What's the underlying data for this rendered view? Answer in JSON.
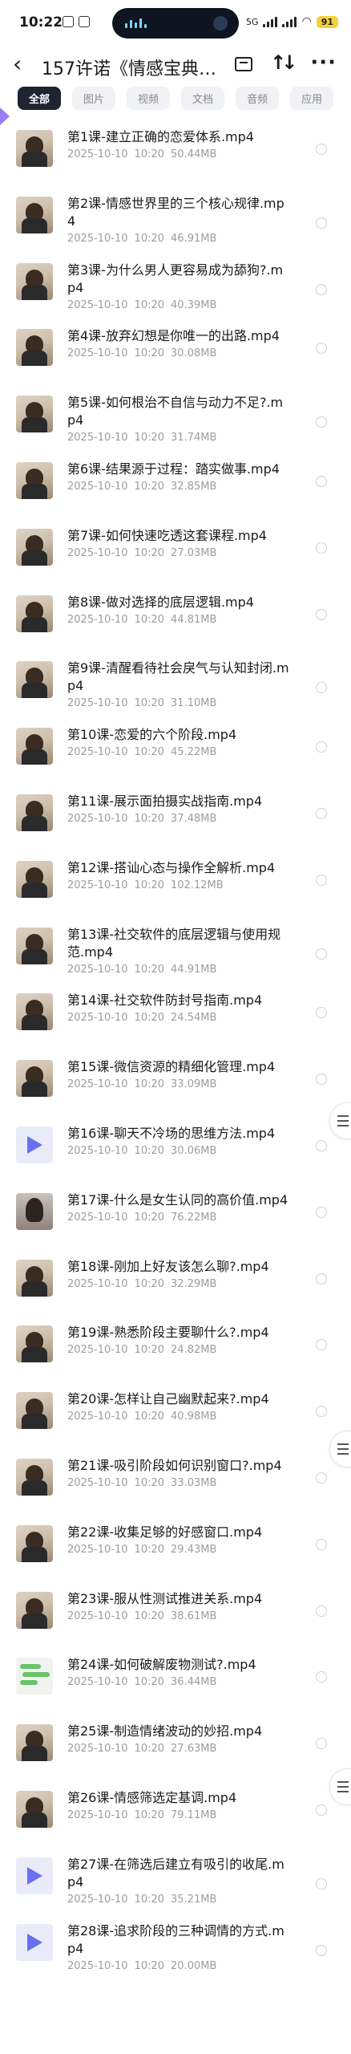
{
  "status": {
    "time": "10:22",
    "battery": "91",
    "network": "5G"
  },
  "header": {
    "title": "157许诺《情感宝典…"
  },
  "tabs": [
    {
      "label": "全部",
      "active": true
    },
    {
      "label": "图片",
      "active": false
    },
    {
      "label": "视频",
      "active": false
    },
    {
      "label": "文档",
      "active": false
    },
    {
      "label": "音频",
      "active": false
    },
    {
      "label": "应用",
      "active": false
    }
  ],
  "files": [
    {
      "name": "第1课-建立正确的恋爱体系.mp4",
      "date": "2025-10-10",
      "time": "10:20",
      "size": "50.44MB",
      "thumb": "video"
    },
    {
      "name": "第2课-情感世界里的三个核心规律.mp4",
      "date": "2025-10-10",
      "time": "10:20",
      "size": "46.91MB",
      "thumb": "video"
    },
    {
      "name": "第3课-为什么男人更容易成为舔狗?.mp4",
      "date": "2025-10-10",
      "time": "10:20",
      "size": "40.39MB",
      "thumb": "video"
    },
    {
      "name": "第4课-放弃幻想是你唯一的出路.mp4",
      "date": "2025-10-10",
      "time": "10:20",
      "size": "30.08MB",
      "thumb": "video"
    },
    {
      "name": "第5课-如何根治不自信与动力不足?.mp4",
      "date": "2025-10-10",
      "time": "10:20",
      "size": "31.74MB",
      "thumb": "video"
    },
    {
      "name": "第6课-结果源于过程：踏实做事.mp4",
      "date": "2025-10-10",
      "time": "10:20",
      "size": "32.85MB",
      "thumb": "video"
    },
    {
      "name": "第7课-如何快速吃透这套课程.mp4",
      "date": "2025-10-10",
      "time": "10:20",
      "size": "27.03MB",
      "thumb": "video"
    },
    {
      "name": "第8课-做对选择的底层逻辑.mp4",
      "date": "2025-10-10",
      "time": "10:20",
      "size": "44.81MB",
      "thumb": "video"
    },
    {
      "name": "第9课-清醒看待社会戾气与认知封闭.mp4",
      "date": "2025-10-10",
      "time": "10:20",
      "size": "31.10MB",
      "thumb": "video"
    },
    {
      "name": "第10课-恋爱的六个阶段.mp4",
      "date": "2025-10-10",
      "time": "10:20",
      "size": "45.22MB",
      "thumb": "video"
    },
    {
      "name": "第11课-展示面拍摄实战指南.mp4",
      "date": "2025-10-10",
      "time": "10:20",
      "size": "37.48MB",
      "thumb": "video"
    },
    {
      "name": "第12课-搭讪心态与操作全解析.mp4",
      "date": "2025-10-10",
      "time": "10:20",
      "size": "102.12MB",
      "thumb": "video"
    },
    {
      "name": "第13课-社交软件的底层逻辑与使用规范.mp4",
      "date": "2025-10-10",
      "time": "10:20",
      "size": "44.91MB",
      "thumb": "video"
    },
    {
      "name": "第14课-社交软件防封号指南.mp4",
      "date": "2025-10-10",
      "time": "10:20",
      "size": "24.54MB",
      "thumb": "video"
    },
    {
      "name": "第15课-微信资源的精细化管理.mp4",
      "date": "2025-10-10",
      "time": "10:20",
      "size": "33.09MB",
      "thumb": "video"
    },
    {
      "name": "第16课-聊天不冷场的思维方法.mp4",
      "date": "2025-10-10",
      "time": "10:20",
      "size": "30.06MB",
      "thumb": "generic"
    },
    {
      "name": "第17课-什么是女生认同的高价值.mp4",
      "date": "2025-10-10",
      "time": "10:20",
      "size": "76.22MB",
      "thumb": "girl"
    },
    {
      "name": "第18课-刚加上好友该怎么聊?.mp4",
      "date": "2025-10-10",
      "time": "10:20",
      "size": "32.29MB",
      "thumb": "video"
    },
    {
      "name": "第19课-熟悉阶段主要聊什么?.mp4",
      "date": "2025-10-10",
      "time": "10:20",
      "size": "24.82MB",
      "thumb": "video"
    },
    {
      "name": "第20课-怎样让自己幽默起来?.mp4",
      "date": "2025-10-10",
      "time": "10:20",
      "size": "40.98MB",
      "thumb": "video"
    },
    {
      "name": "第21课-吸引阶段如何识别窗口?.mp4",
      "date": "2025-10-10",
      "time": "10:20",
      "size": "33.03MB",
      "thumb": "video"
    },
    {
      "name": "第22课-收集足够的好感窗口.mp4",
      "date": "2025-10-10",
      "time": "10:20",
      "size": "29.43MB",
      "thumb": "video"
    },
    {
      "name": "第23课-服从性测试推进关系.mp4",
      "date": "2025-10-10",
      "time": "10:20",
      "size": "38.61MB",
      "thumb": "video"
    },
    {
      "name": "第24课-如何破解废物测试?.mp4",
      "date": "2025-10-10",
      "time": "10:20",
      "size": "36.44MB",
      "thumb": "green"
    },
    {
      "name": "第25课-制造情绪波动的妙招.mp4",
      "date": "2025-10-10",
      "time": "10:20",
      "size": "27.63MB",
      "thumb": "video"
    },
    {
      "name": "第26课-情感筛选定基调.mp4",
      "date": "2025-10-10",
      "time": "10:20",
      "size": "79.11MB",
      "thumb": "video"
    },
    {
      "name": "第27课-在筛选后建立有吸引的收尾.mp4",
      "date": "2025-10-10",
      "time": "10:20",
      "size": "35.21MB",
      "thumb": "generic"
    },
    {
      "name": "第28课-追求阶段的三种调情的方式.mp4",
      "date": "2025-10-10",
      "time": "10:20",
      "size": "20.00MB",
      "thumb": "generic"
    }
  ]
}
